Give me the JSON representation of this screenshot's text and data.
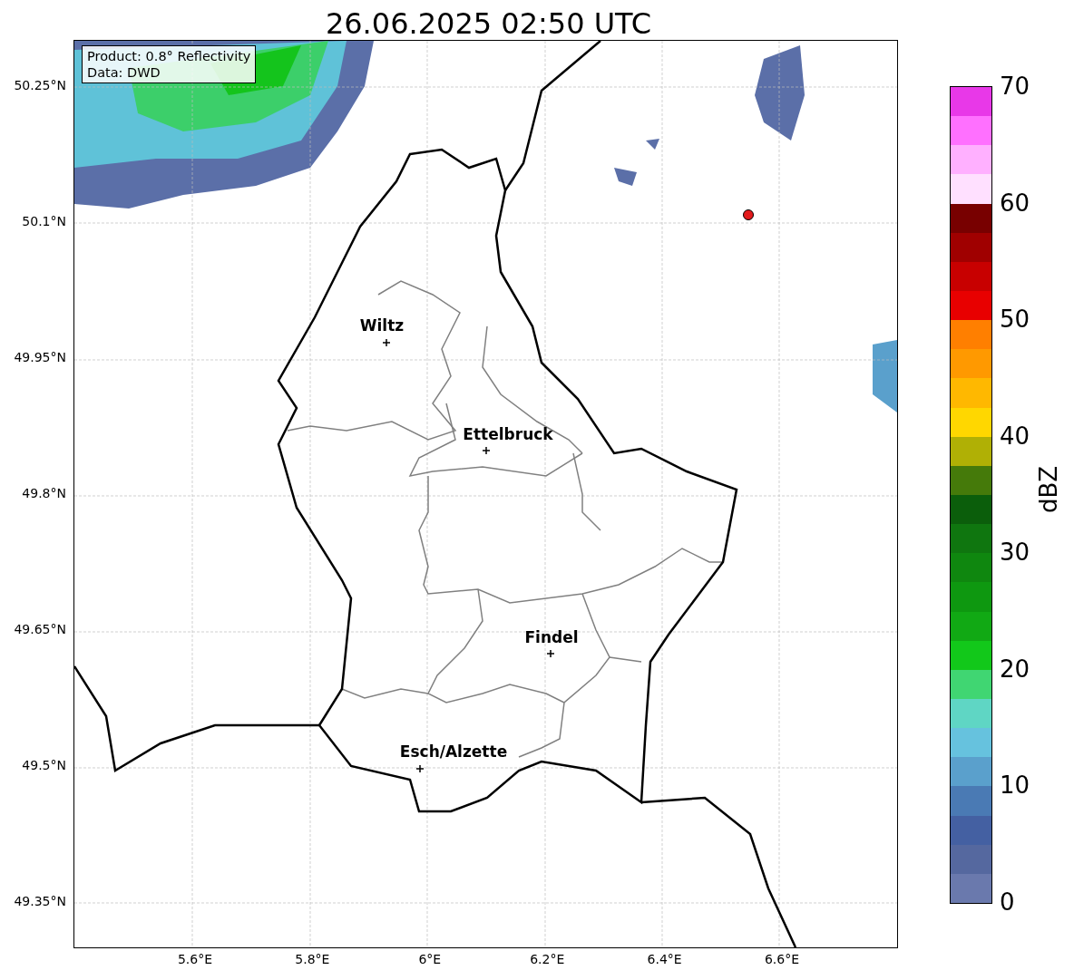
{
  "title": "26.06.2025 02:50 UTC",
  "map": {
    "info": [
      "Product: 0.8° Reflectivity",
      "Data: DWD"
    ],
    "cities": [
      {
        "name": "Wiltz"
      },
      {
        "name": "Ettelbruck"
      },
      {
        "name": "Findel"
      },
      {
        "name": "Esch/Alzette"
      }
    ],
    "lat_labels": [
      "50.25°N",
      "50.1°N",
      "49.95°N",
      "49.8°N",
      "49.65°N",
      "49.5°N",
      "49.35°N"
    ],
    "lon_labels": [
      "5.6°E",
      "5.8°E",
      "6°E",
      "6.2°E",
      "6.4°E",
      "6.6°E"
    ]
  },
  "colorbar": {
    "label": "dBZ",
    "ticks": [
      "70",
      "60",
      "50",
      "40",
      "30",
      "20",
      "10",
      "0"
    ],
    "segments": [
      {
        "color": "#e838e8"
      },
      {
        "color": "#ff70ff"
      },
      {
        "color": "#ffb0ff"
      },
      {
        "color": "#ffe0ff"
      },
      {
        "color": "#780000"
      },
      {
        "color": "#a00000"
      },
      {
        "color": "#c80000"
      },
      {
        "color": "#e80000"
      },
      {
        "color": "#ff7f00"
      },
      {
        "color": "#ff9900"
      },
      {
        "color": "#ffb800"
      },
      {
        "color": "#ffd700"
      },
      {
        "color": "#b0b005"
      },
      {
        "color": "#457a0a"
      },
      {
        "color": "#0b5e0b"
      },
      {
        "color": "#0f760f"
      },
      {
        "color": "#0f870f"
      },
      {
        "color": "#0e9810"
      },
      {
        "color": "#11a914"
      },
      {
        "color": "#12c81a"
      },
      {
        "color": "#40d672"
      },
      {
        "color": "#5fd6c4"
      },
      {
        "color": "#66c2de"
      },
      {
        "color": "#5aa0cc"
      },
      {
        "color": "#4a7ab4"
      },
      {
        "color": "#4460a2"
      },
      {
        "color": "#55689f"
      },
      {
        "color": "#6a79ad"
      }
    ]
  }
}
